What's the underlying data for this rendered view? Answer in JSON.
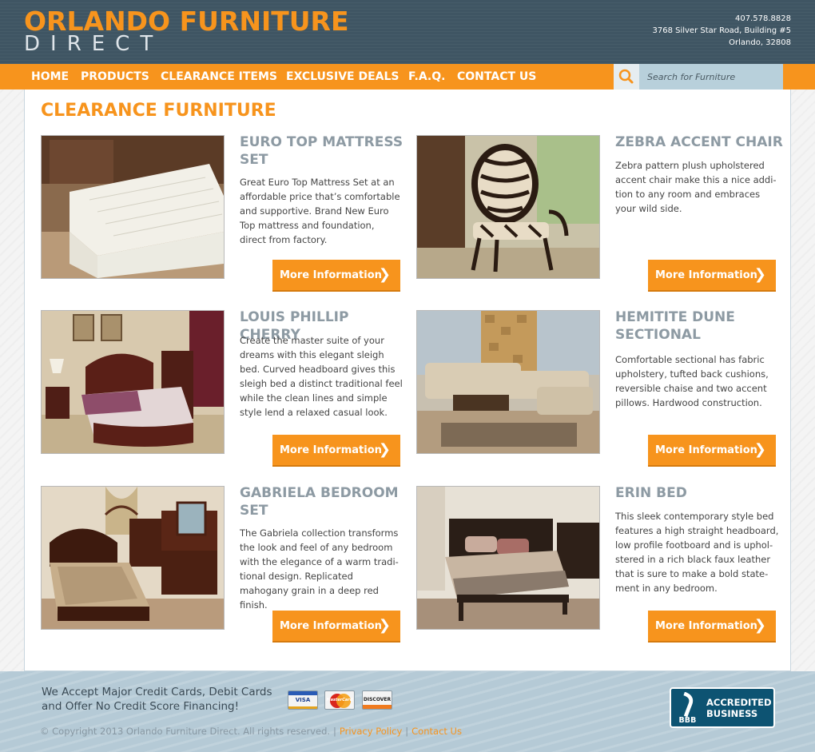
{
  "header": {
    "logo_line1": "ORLANDO FURNITURE",
    "logo_line2": "DIRECT",
    "phone": "407.578.8828",
    "address1": "3768 Silver Star Road, Building #5",
    "address2": "Orlando, 32808"
  },
  "nav": {
    "items": [
      "HOME",
      "PRODUCTS",
      "CLEARANCE ITEMS",
      "EXCLUSIVE DEALS",
      "F.A.Q.",
      "CONTACT US"
    ]
  },
  "search": {
    "placeholder": "Search for Furniture",
    "icon": "search-icon"
  },
  "page_title": "CLEARANCE FURNITURE",
  "products": [
    {
      "title": "EURO TOP MATTRESS SET",
      "description": "Great Euro Top Mattress Set at an affordable price that’s comfortable and supportive. Brand New Euro Top mattress and foundation, direct from factory.",
      "button": "More Information"
    },
    {
      "title": "ZEBRA ACCENT CHAIR",
      "description": "Zebra pattern plush upholstered accent chair make this a nice addi-tion to any room and embraces your wild side.",
      "button": "More Information"
    },
    {
      "title": "LOUIS PHILLIP CHERRY",
      "description": "Create the master suite of your dreams with this elegant sleigh bed. Curved headboard gives this sleigh bed a distinct traditional feel while the clean lines and simple style lend a relaxed casual look.",
      "button": "More Information"
    },
    {
      "title": "HEMITITE DUNE SECTIONAL",
      "description": "Comfortable sectional has fabric upholstery, tufted back cushions, reversible chaise and two accent pillows. Hardwood construction.",
      "button": "More Information"
    },
    {
      "title": "GABRIELA BEDROOM SET",
      "description": "The Gabriela collection transforms the look and feel of any bedroom with the elegance of a warm tradi-tional design. Replicated mahogany grain in a deep red finish.",
      "button": "More Information"
    },
    {
      "title": "ERIN BED",
      "description": "This sleek contemporary style bed features a high straight headboard, low profile footboard and is uphol-stered in a rich black faux leather that is sure to make a bold state-ment in any bedroom.",
      "button": "More Information"
    }
  ],
  "footer": {
    "payment_text": "We Accept Major Credit Cards, Debit Cards and Offer No Credit Score Financing!",
    "cards": [
      "VISA",
      "MasterCard",
      "DISCOVER"
    ],
    "copyright": "© Copyright 2013 Orlando Furniture Direct. All rights reserved.",
    "privacy": "Privacy Policy",
    "contact": "Contact Us",
    "bbb_line1": "ACCREDITED",
    "bbb_line2": "BUSINESS",
    "bbb_logo": "BBB"
  },
  "colors": {
    "accent": "#f7941d",
    "header_bg": "#3f5563",
    "title_gray": "#8d9aa3",
    "footer_bg": "#b5cad6"
  }
}
